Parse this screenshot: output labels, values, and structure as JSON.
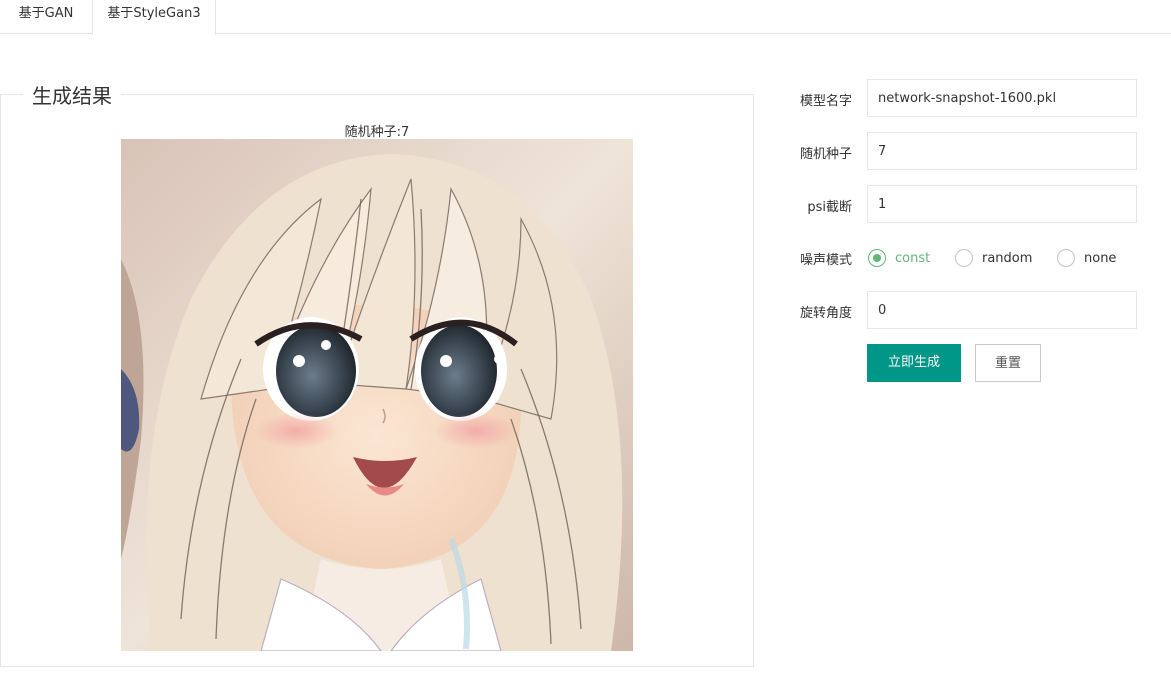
{
  "tabs": [
    {
      "label": "基于GAN",
      "active": false
    },
    {
      "label": "基于StyleGan3",
      "active": true
    }
  ],
  "result": {
    "legend": "生成结果",
    "seed_caption": "随机种子:7",
    "image_desc": "generated-anime-face"
  },
  "form": {
    "model_name": {
      "label": "模型名字",
      "value": "network-snapshot-1600.pkl"
    },
    "seed": {
      "label": "随机种子",
      "value": "7"
    },
    "psi": {
      "label": "psi截断",
      "value": "1"
    },
    "noise": {
      "label": "噪声模式",
      "options": [
        "const",
        "random",
        "none"
      ],
      "selected": "const"
    },
    "rotation": {
      "label": "旋转角度",
      "value": "0"
    }
  },
  "buttons": {
    "generate": "立即生成",
    "reset": "重置"
  },
  "colors": {
    "primary": "#009688",
    "radio_checked": "#5fb878",
    "border": "#e6e6e6"
  }
}
